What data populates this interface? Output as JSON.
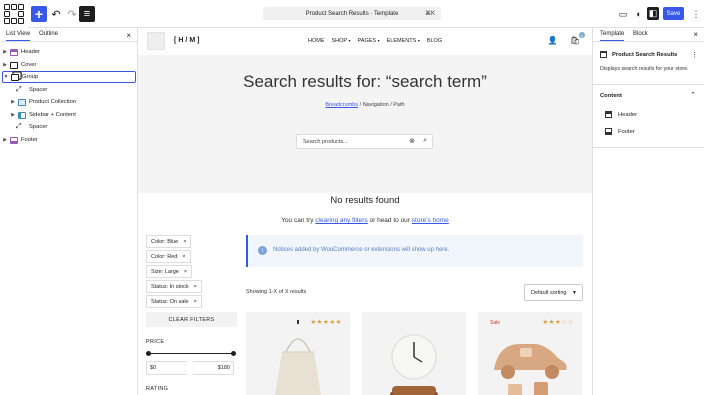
{
  "topbar": {
    "command_text": "Product Search Results · Template",
    "shortcut": "⌘K",
    "save_label": "Save"
  },
  "left_panel": {
    "tabs": [
      "List View",
      "Outline"
    ],
    "items": [
      {
        "label": "Header",
        "color": "#9b59b6"
      },
      {
        "label": "Cover",
        "color": "#1e1e1e"
      },
      {
        "label": "Group",
        "color": "#1e1e1e"
      },
      {
        "label": "Spacer",
        "color": "#1e1e1e"
      },
      {
        "label": "Product Collection",
        "color": "#3c8dbc"
      },
      {
        "label": "Sidebar + Content",
        "color": "#3c8dbc"
      },
      {
        "label": "Spacer",
        "color": "#1e1e1e"
      },
      {
        "label": "Footer",
        "color": "#9b59b6"
      }
    ]
  },
  "site": {
    "brand": "[H/M]",
    "nav": [
      "HOME",
      "SHOP",
      "PAGES",
      "ELEMENTS",
      "BLOG"
    ],
    "cart_count": "0"
  },
  "search": {
    "title": "Search results for: “search term”",
    "breadcrumb_link": "Breadcrumbs",
    "breadcrumb_rest": " / Navigation / Path",
    "placeholder": "Search products..."
  },
  "results": {
    "no_results": "No results found",
    "try_prefix": "You can try ",
    "try_link1": "clearing any filters",
    "try_mid": " or head to our ",
    "try_link2": "store's home",
    "notice": "Notices added by WooCommerce or extensions will show up here.",
    "showing": "Showing 1-X of X results",
    "sort": "Default sorting"
  },
  "filters": {
    "chips": [
      "Color: Blue",
      "Color: Red",
      "Size: Large",
      "Status: In stock",
      "Status: On sale"
    ],
    "clear_label": "CLEAR FILTERS",
    "price_label": "PRICE",
    "min": "$0",
    "max": "$180",
    "rating_label": "RATING"
  },
  "products": [
    {
      "rating": 5,
      "sale": ""
    },
    {
      "rating": 0,
      "sale": ""
    },
    {
      "rating": 3,
      "sale": "Sale"
    }
  ],
  "right_panel": {
    "tabs": [
      "Template",
      "Block"
    ],
    "template_name": "Product Search Results",
    "description": "Displays search results for your store.",
    "content_label": "Content",
    "items": [
      "Header",
      "Footer"
    ]
  }
}
